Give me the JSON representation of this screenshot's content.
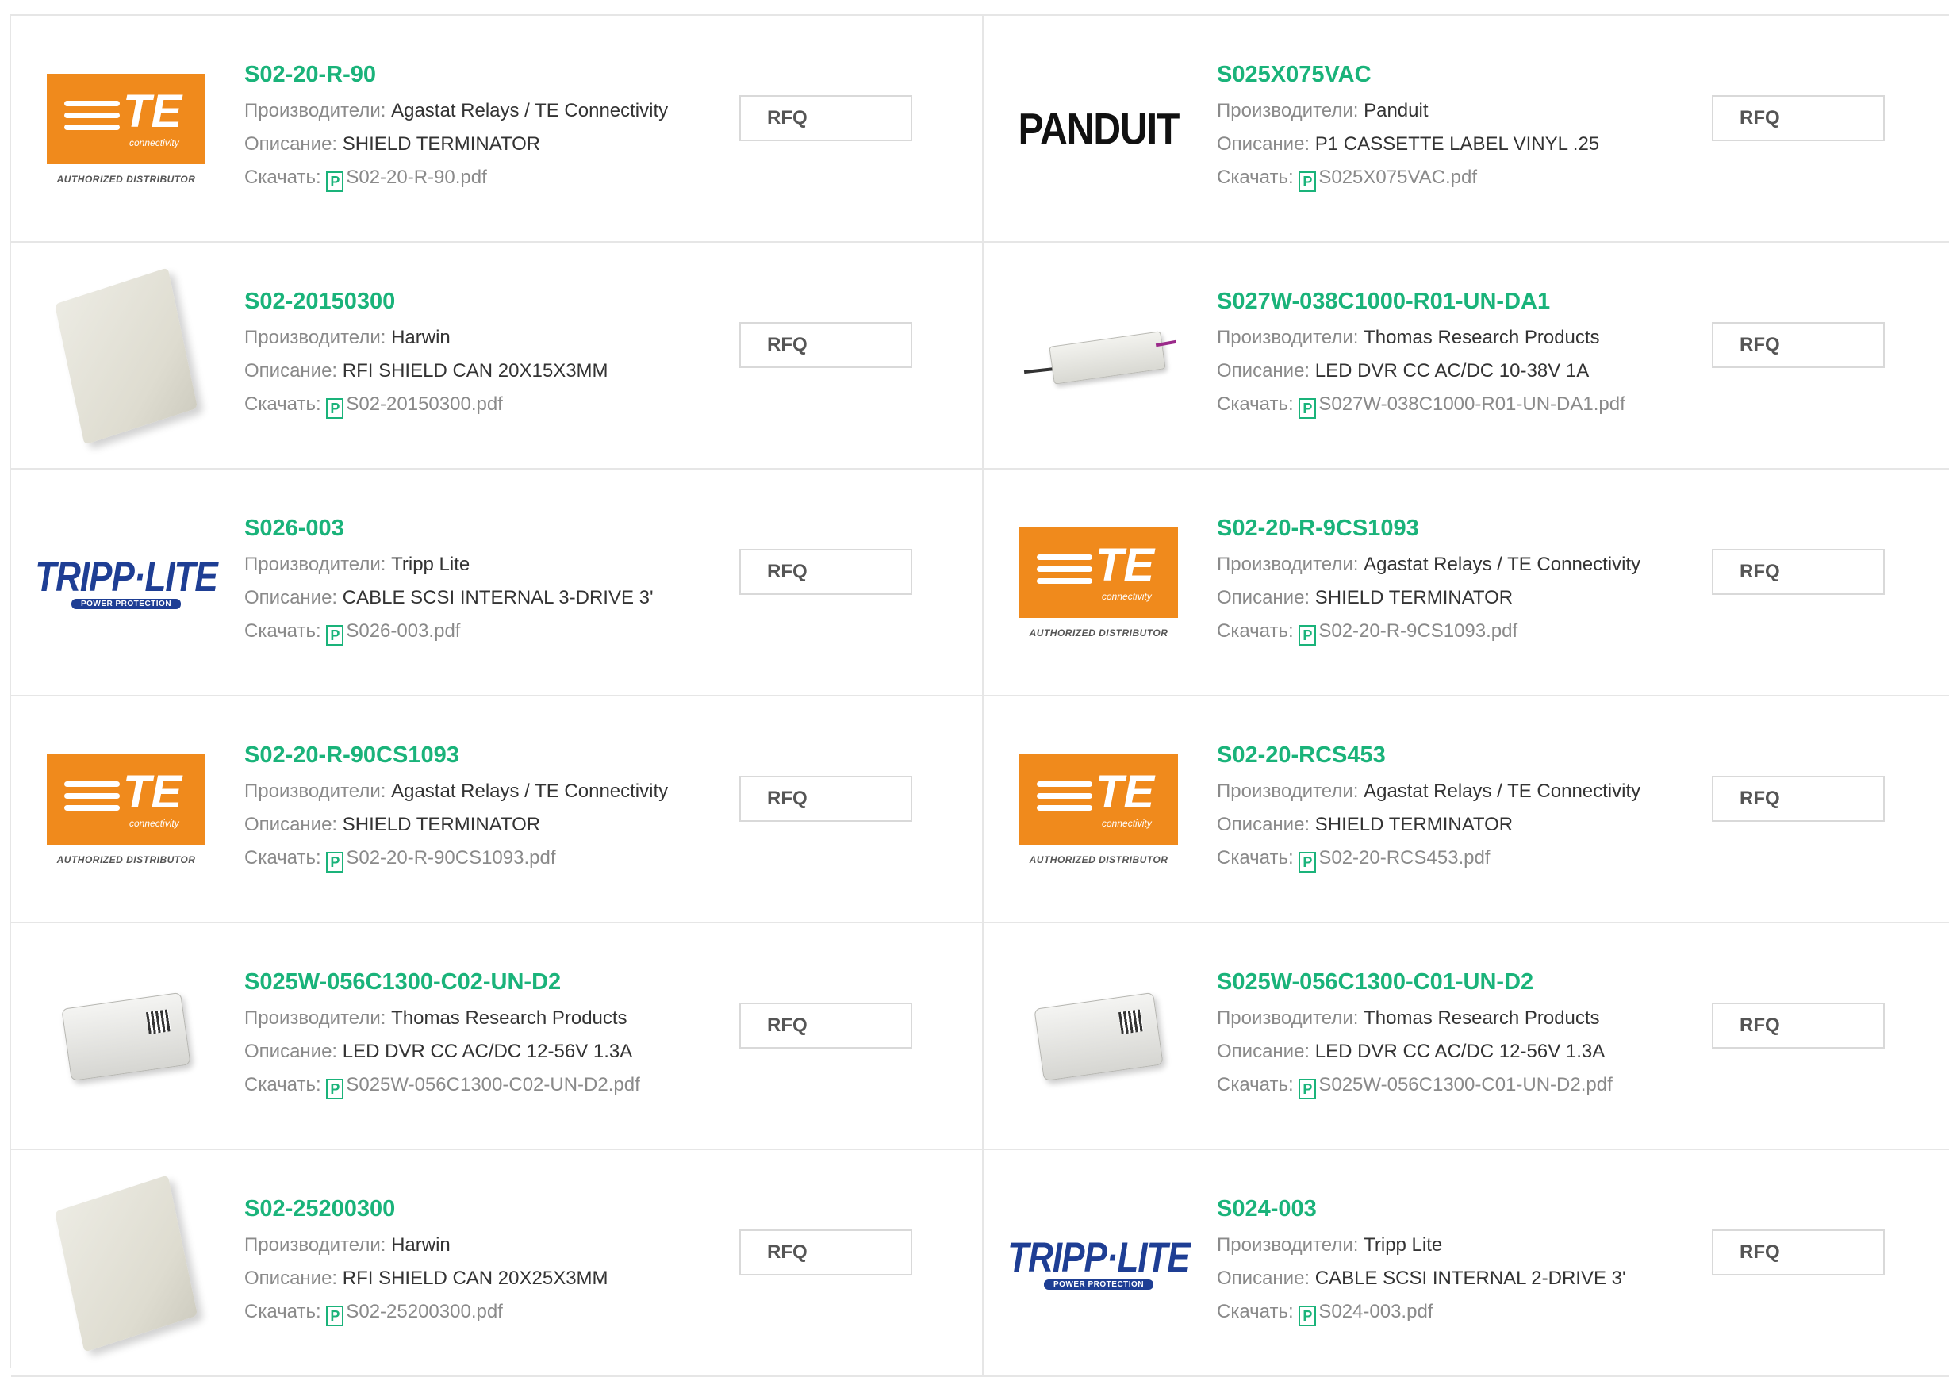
{
  "labels": {
    "manufacturer": "Производители:",
    "description": "Описание:",
    "download": "Скачать:",
    "rfq": "RFQ",
    "pdf_glyph": "P"
  },
  "logos": {
    "te_letters": "TE",
    "te_sub": "connectivity",
    "te_authorized": "AUTHORIZED DISTRIBUTOR",
    "panduit": "PANDUIT",
    "tripp_text": "TRIPP·LITE",
    "tripp_sub": "POWER PROTECTION"
  },
  "colors": {
    "part_number": "#1ab37a",
    "label_gray": "#8a8a8a",
    "te_orange": "#f08a1c",
    "tripp_blue": "#1e3e94"
  },
  "products": [
    {
      "pn": "S02-20-R-90",
      "manufacturer": "Agastat Relays / TE Connectivity",
      "description": "SHIELD TERMINATOR",
      "pdf": "S02-20-R-90.pdf",
      "image": "te-logo"
    },
    {
      "pn": "S025X075VAC",
      "manufacturer": "Panduit",
      "description": "P1 CASSETTE LABEL VINYL .25",
      "pdf": "S025X075VAC.pdf",
      "image": "panduit-logo"
    },
    {
      "pn": "S02-20150300",
      "manufacturer": "Harwin",
      "description": "RFI SHIELD CAN 20X15X3MM",
      "pdf": "S02-20150300.pdf",
      "image": "shield-can"
    },
    {
      "pn": "S027W-038C1000-R01-UN-DA1",
      "manufacturer": "Thomas Research Products",
      "description": "LED DVR CC AC/DC 10-38V 1A",
      "pdf": "S027W-038C1000-R01-UN-DA1.pdf",
      "image": "led-driver-long"
    },
    {
      "pn": "S026-003",
      "manufacturer": "Tripp Lite",
      "description": "CABLE SCSI INTERNAL 3-DRIVE 3'",
      "pdf": "S026-003.pdf",
      "image": "tripp-logo"
    },
    {
      "pn": "S02-20-R-9CS1093",
      "manufacturer": "Agastat Relays / TE Connectivity",
      "description": "SHIELD TERMINATOR",
      "pdf": "S02-20-R-9CS1093.pdf",
      "image": "te-logo"
    },
    {
      "pn": "S02-20-R-90CS1093",
      "manufacturer": "Agastat Relays / TE Connectivity",
      "description": "SHIELD TERMINATOR",
      "pdf": "S02-20-R-90CS1093.pdf",
      "image": "te-logo"
    },
    {
      "pn": "S02-20-RCS453",
      "manufacturer": "Agastat Relays / TE Connectivity",
      "description": "SHIELD TERMINATOR",
      "pdf": "S02-20-RCS453.pdf",
      "image": "te-logo"
    },
    {
      "pn": "S025W-056C1300-C02-UN-D2",
      "manufacturer": "Thomas Research Products",
      "description": "LED DVR CC AC/DC 12-56V 1.3A",
      "pdf": "S025W-056C1300-C02-UN-D2.pdf",
      "image": "led-driver-box"
    },
    {
      "pn": "S025W-056C1300-C01-UN-D2",
      "manufacturer": "Thomas Research Products",
      "description": "LED DVR CC AC/DC 12-56V 1.3A",
      "pdf": "S025W-056C1300-C01-UN-D2.pdf",
      "image": "led-driver-box"
    },
    {
      "pn": "S02-25200300",
      "manufacturer": "Harwin",
      "description": "RFI SHIELD CAN 20X25X3MM",
      "pdf": "S02-25200300.pdf",
      "image": "shield-can"
    },
    {
      "pn": "S024-003",
      "manufacturer": "Tripp Lite",
      "description": "CABLE SCSI INTERNAL 2-DRIVE 3'",
      "pdf": "S024-003.pdf",
      "image": "tripp-logo"
    }
  ]
}
